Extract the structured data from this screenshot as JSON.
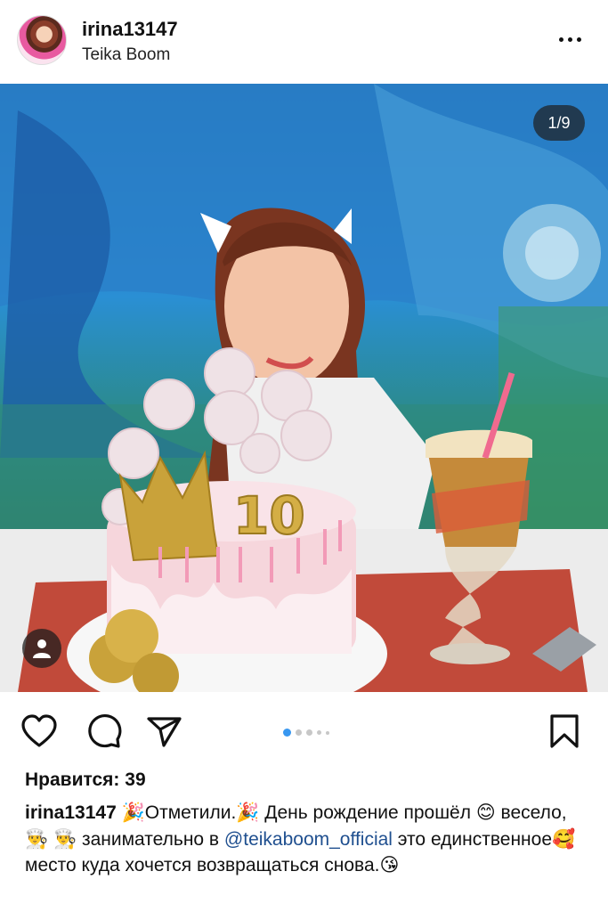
{
  "post": {
    "username": "irina13147",
    "location": "Teika Boom",
    "photo_counter": "1/9",
    "carousel_index": 1,
    "carousel_total": 9
  },
  "likes": {
    "text": "Нравится: 39"
  },
  "caption": {
    "username": "irina13147",
    "part1": "🎉Отметили.🎉 День рождение прошёл 😊 весело, 👨‍🍳 👨‍🍳 занимательно в ",
    "mention": "@teikaboom_official",
    "part2": " это единственное🥰 место куда хочется возвращаться снова.😘"
  },
  "icons": {
    "more": "more-options-icon",
    "like": "heart-icon",
    "comment": "comment-icon",
    "share": "send-icon",
    "save": "bookmark-icon",
    "tag": "user-tag-icon"
  },
  "colors": {
    "accent": "#3897f0",
    "mention": "#1f4f8f"
  }
}
